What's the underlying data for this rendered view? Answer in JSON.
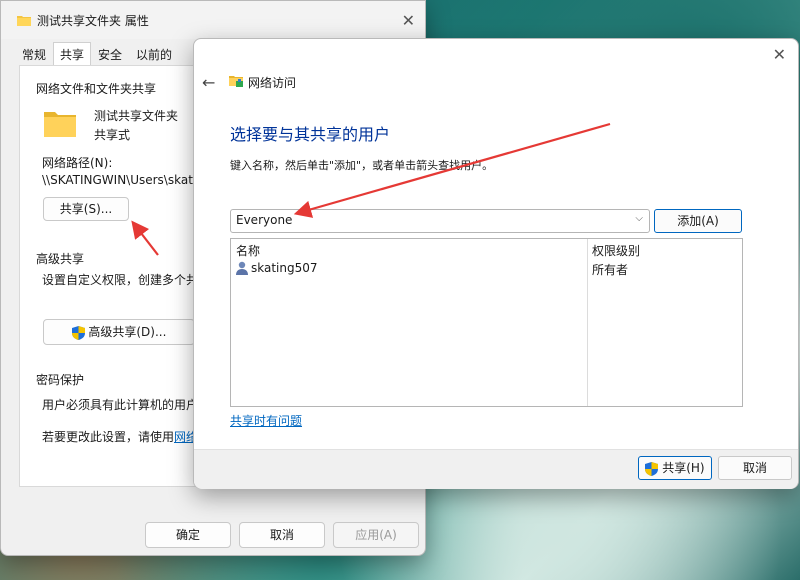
{
  "props": {
    "title": "测试共享文件夹 属性",
    "tabs": [
      "常规",
      "共享",
      "安全",
      "以前的"
    ],
    "network_group_title": "网络文件和文件夹共享",
    "folder_name": "测试共享文件夹",
    "folder_status": "共享式",
    "network_path_label": "网络路径(N):",
    "network_path_value": "\\\\SKATINGWIN\\Users\\skati\\",
    "share_button": "共享(S)...",
    "advanced_group_title": "高级共享",
    "advanced_desc": "设置自定义权限，创建多个共",
    "advanced_button": "高级共享(D)...",
    "password_group_title": "密码保护",
    "password_desc": "用户必须具有此计算机的用户",
    "change_prefix": "若要更改此设置，请使用",
    "change_link": "网络",
    "ok": "确定",
    "cancel": "取消",
    "apply": "应用(A)"
  },
  "net": {
    "title": "网络访问",
    "heading": "选择要与其共享的用户",
    "description": "键入名称，然后单击\"添加\"，或者单击箭头查找用户。",
    "combo_value": "Everyone",
    "add_button": "添加(A)",
    "col_name": "名称",
    "col_perm": "权限级别",
    "users": [
      {
        "name": "skating507",
        "perm": "所有者"
      }
    ],
    "trouble_link": "共享时有问题",
    "share_button": "共享(H)",
    "cancel_button": "取消"
  },
  "colors": {
    "accent": "#0067c0",
    "heading": "#003399",
    "annotation_arrow": "#e53935"
  }
}
